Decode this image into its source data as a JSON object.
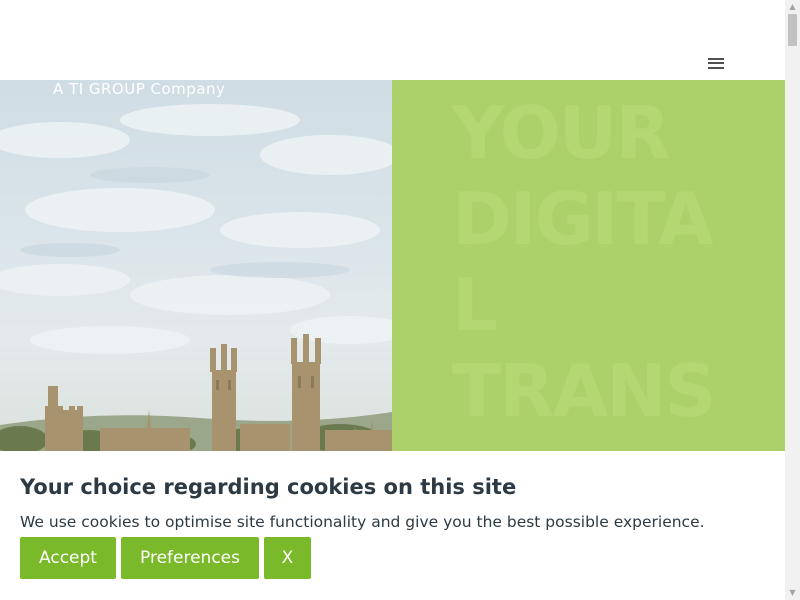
{
  "header": {
    "menu_icon": "hamburger-menu-icon"
  },
  "hero": {
    "tagline": "A TI GROUP Company",
    "overlay_words": [
      "YOUR",
      "DIGITA",
      "L",
      "TRANS"
    ]
  },
  "cookie_banner": {
    "title": "Your choice regarding cookies on this site",
    "text": "We use cookies to optimise site functionality and give you the best possible experience.",
    "accept_label": "Accept",
    "preferences_label": "Preferences",
    "close_label": "X"
  },
  "colors": {
    "accent_green": "#7ab929",
    "hero_green": "#acd16a",
    "text_dark": "#2d3a44"
  }
}
